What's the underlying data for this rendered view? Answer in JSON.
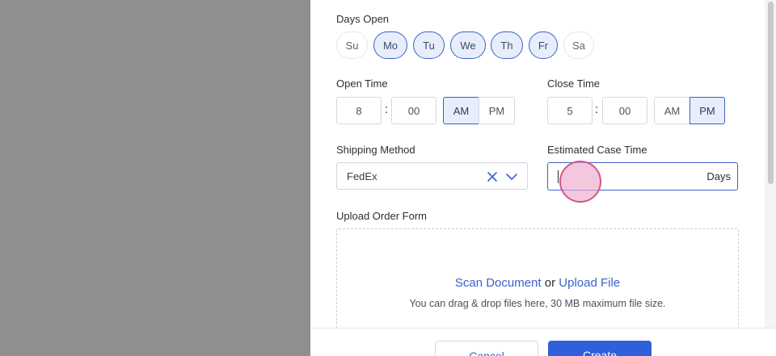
{
  "days_open": {
    "label": "Days Open",
    "days": [
      {
        "label": "Su",
        "selected": false
      },
      {
        "label": "Mo",
        "selected": true
      },
      {
        "label": "Tu",
        "selected": true
      },
      {
        "label": "We",
        "selected": true
      },
      {
        "label": "Th",
        "selected": true
      },
      {
        "label": "Fr",
        "selected": true
      },
      {
        "label": "Sa",
        "selected": false
      }
    ]
  },
  "open_time": {
    "label": "Open Time",
    "hour": "8",
    "minute": "00",
    "separator": ":",
    "am": "AM",
    "pm": "PM",
    "selected": "AM"
  },
  "close_time": {
    "label": "Close Time",
    "hour": "5",
    "minute": "00",
    "separator": ":",
    "am": "AM",
    "pm": "PM",
    "selected": "PM"
  },
  "shipping_method": {
    "label": "Shipping Method",
    "value": "FedEx",
    "clear_icon": "close-icon",
    "dropdown_icon": "chevron-down-icon"
  },
  "estimated_case_time": {
    "label": "Estimated Case Time",
    "value": "",
    "unit": "Days"
  },
  "upload_order_form": {
    "label": "Upload Order Form",
    "scan_link": "Scan Document",
    "or_text": "or",
    "upload_link": "Upload File",
    "hint": "You can drag & drop files here, 30 MB maximum file size."
  },
  "footer": {
    "cancel_label": "Cancel",
    "create_label": "Create"
  },
  "colors": {
    "accent": "#3a63c8",
    "selected_bg": "#e7edfb",
    "primary_button": "#2f5fd9",
    "overlay": "#8f8f8f"
  }
}
